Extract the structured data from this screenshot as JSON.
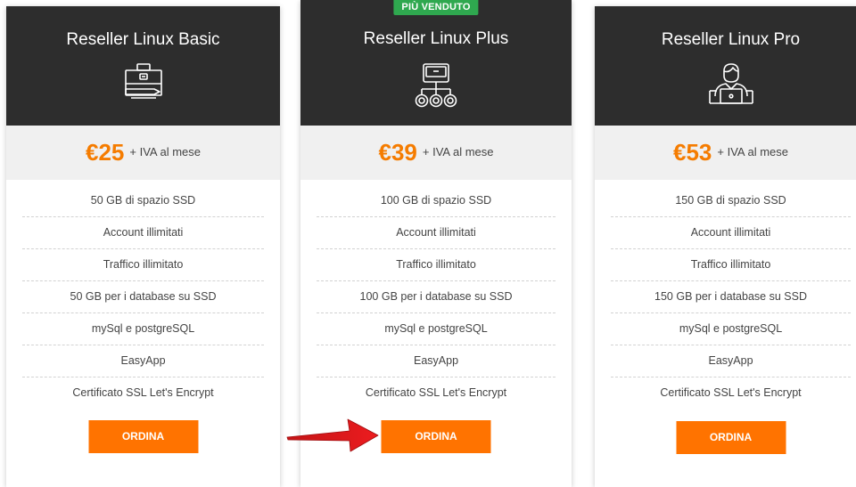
{
  "plans": [
    {
      "title": "Reseller Linux Basic",
      "icon": "briefcase-icon",
      "price": "€25",
      "price_note": "+ IVA al mese",
      "features": [
        "50 GB di spazio SSD",
        "Account illimitati",
        "Traffico illimitato",
        "50 GB per i database su SSD",
        "mySql e postgreSQL",
        "EasyApp",
        "Certificato SSL Let's Encrypt"
      ],
      "button_label": "ORDINA"
    },
    {
      "title": "Reseller Linux Plus",
      "badge": "PIÙ VENDUTO",
      "icon": "network-icon",
      "price": "€39",
      "price_note": "+ IVA al mese",
      "features": [
        "100 GB di spazio SSD",
        "Account illimitati",
        "Traffico illimitato",
        "100 GB per i database su SSD",
        "mySql e postgreSQL",
        "EasyApp",
        "Certificato SSL Let's Encrypt"
      ],
      "button_label": "ORDINA"
    },
    {
      "title": "Reseller Linux Pro",
      "icon": "user-laptop-icon",
      "price": "€53",
      "price_note": "+ IVA al mese",
      "features": [
        "150 GB di spazio SSD",
        "Account illimitati",
        "Traffico illimitato",
        "150 GB per i database su SSD",
        "mySql e postgreSQL",
        "EasyApp",
        "Certificato SSL Let's Encrypt"
      ],
      "button_label": "ORDINA"
    }
  ],
  "colors": {
    "header_bg": "#2d2d2d",
    "accent_orange": "#ff7300",
    "price_orange": "#f57c00",
    "badge_green": "#2fa84f",
    "arrow_red": "#e0181b"
  }
}
